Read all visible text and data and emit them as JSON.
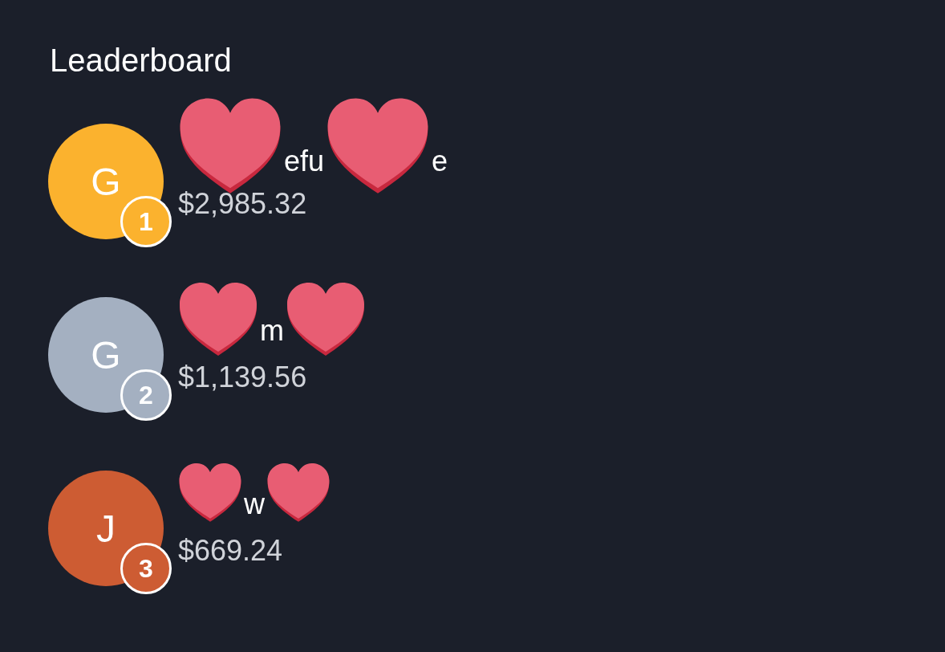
{
  "title": "Leaderboard",
  "entries": [
    {
      "initial": "G",
      "rank": "1",
      "color": "#fbb22e",
      "amount": "$2,985.32",
      "name_parts": [
        {
          "kind": "cover"
        },
        {
          "kind": "text",
          "text": "efu"
        },
        {
          "kind": "cover"
        },
        {
          "kind": "text",
          "text": "e"
        }
      ]
    },
    {
      "initial": "G",
      "rank": "2",
      "color": "#a4b0c1",
      "amount": "$1,139.56",
      "name_parts": [
        {
          "kind": "cover"
        },
        {
          "kind": "text",
          "text": "m"
        },
        {
          "kind": "cover"
        }
      ]
    },
    {
      "initial": "J",
      "rank": "3",
      "color": "#cd5c33",
      "amount": "$669.24",
      "name_parts": [
        {
          "kind": "cover"
        },
        {
          "kind": "text",
          "text": "w"
        },
        {
          "kind": "cover"
        }
      ]
    }
  ]
}
